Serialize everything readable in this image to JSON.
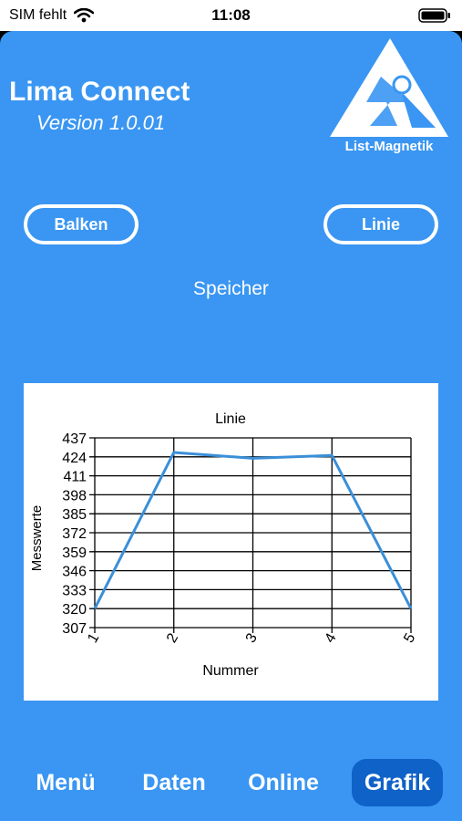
{
  "status": {
    "carrier": "SIM fehlt",
    "time": "11:08"
  },
  "app": {
    "title": "Lima Connect",
    "version": "Version 1.0.01",
    "logo_text": "List-Magnetik"
  },
  "buttons": {
    "bar": "Balken",
    "line": "Linie"
  },
  "storage_label": "Speicher",
  "chart_data": {
    "type": "line",
    "title": "Linie",
    "xlabel": "Nummer",
    "ylabel": "Messwerte",
    "categories": [
      "1",
      "2",
      "3",
      "4",
      "5"
    ],
    "yticks": [
      307,
      320,
      333,
      346,
      359,
      372,
      385,
      398,
      411,
      424,
      437
    ],
    "ylim": [
      307,
      437
    ],
    "series": [
      {
        "values": [
          320,
          427,
          423,
          425,
          320
        ],
        "color": "#3a8fd8"
      }
    ],
    "grid": true
  },
  "tabs": [
    {
      "label": "Menü",
      "active": false
    },
    {
      "label": "Daten",
      "active": false
    },
    {
      "label": "Online",
      "active": false
    },
    {
      "label": "Grafik",
      "active": true
    }
  ]
}
